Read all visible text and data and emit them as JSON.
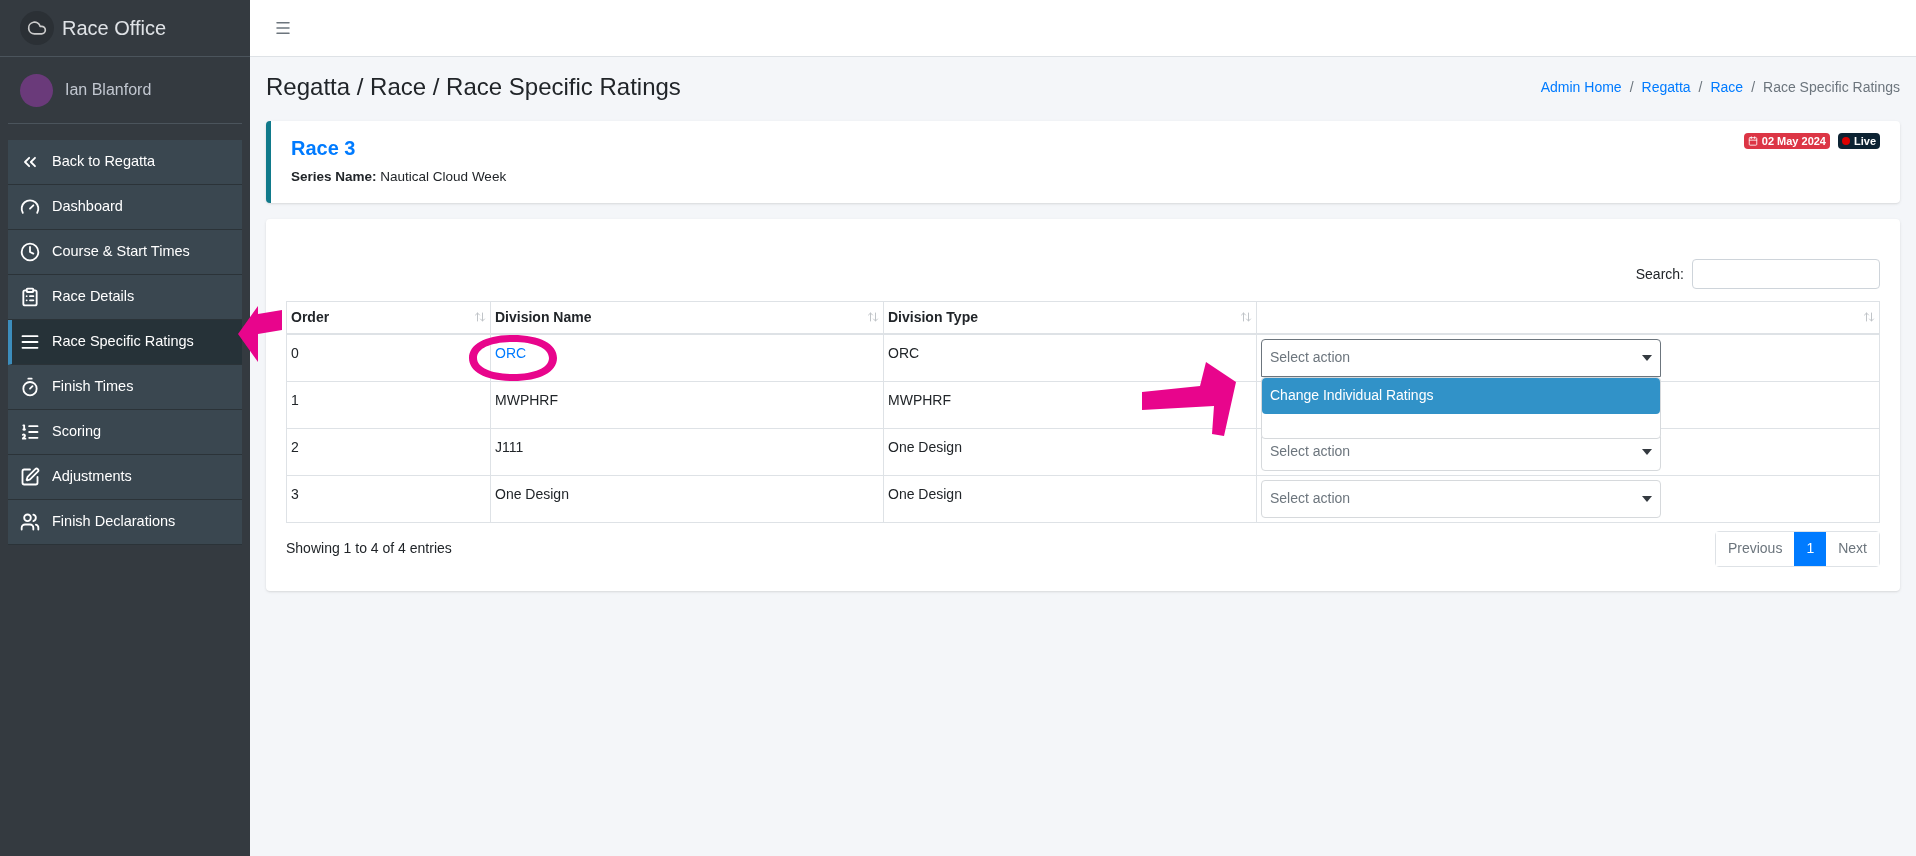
{
  "app": {
    "title": "Race Office"
  },
  "user": {
    "name": "Ian Blanford"
  },
  "sidebar": {
    "items": [
      {
        "label": "Back to Regatta",
        "kind": "back",
        "selected": false
      },
      {
        "label": "Dashboard",
        "kind": "dashboard",
        "selected": false
      },
      {
        "label": "Course & Start Times",
        "kind": "clock",
        "selected": false
      },
      {
        "label": "Race Details",
        "kind": "clipboard",
        "selected": false
      },
      {
        "label": "Race Specific Ratings",
        "kind": "list",
        "selected": true
      },
      {
        "label": "Finish Times",
        "kind": "stopwatch",
        "selected": false
      },
      {
        "label": "Scoring",
        "kind": "numbered",
        "selected": false
      },
      {
        "label": "Adjustments",
        "kind": "edit",
        "selected": false
      },
      {
        "label": "Finish Declarations",
        "kind": "people",
        "selected": false
      }
    ]
  },
  "page": {
    "title": "Regatta / Race / Race Specific Ratings",
    "breadcrumb": [
      {
        "label": "Admin Home",
        "current": false
      },
      {
        "separator": "/",
        "label": "Regatta",
        "current": false
      },
      {
        "separator": "/",
        "label": "Race",
        "current": false
      },
      {
        "separator": "/",
        "label": "Race Specific Ratings",
        "current": true
      }
    ]
  },
  "race_card": {
    "title": "Race 3",
    "series_label": "Series Name:",
    "series_name": "Nautical Cloud Week",
    "date": "02 May 2024",
    "status": "Live"
  },
  "table": {
    "search_label": "Search:",
    "columns": [
      {
        "label": "Order"
      },
      {
        "label": "Division Name"
      },
      {
        "label": "Division Type"
      },
      {}
    ],
    "rows": [
      {
        "order": "0",
        "division_name": "ORC",
        "division_type": "ORC",
        "link": true,
        "action": {
          "placeholder": "Select action",
          "open": true,
          "options": [
            {
              "label": "Change Individual Ratings",
              "selected": true
            }
          ]
        }
      },
      {
        "order": "1",
        "division_name": "MWPHRF",
        "division_type": "MWPHRF",
        "link": false
      },
      {
        "order": "2",
        "division_name": "J111",
        "division_type": "One Design",
        "link": false,
        "action": {
          "placeholder": "Select action",
          "open": false
        }
      },
      {
        "order": "3",
        "division_name": "One Design",
        "division_type": "One Design",
        "link": false,
        "action": {
          "placeholder": "Select action",
          "open": false
        }
      }
    ],
    "info": "Showing 1 to 4 of 4 entries",
    "pagination": [
      {
        "label": "Previous",
        "selected": false
      },
      {
        "label": "1",
        "selected": true
      },
      {
        "label": "Next",
        "selected": false
      }
    ]
  }
}
